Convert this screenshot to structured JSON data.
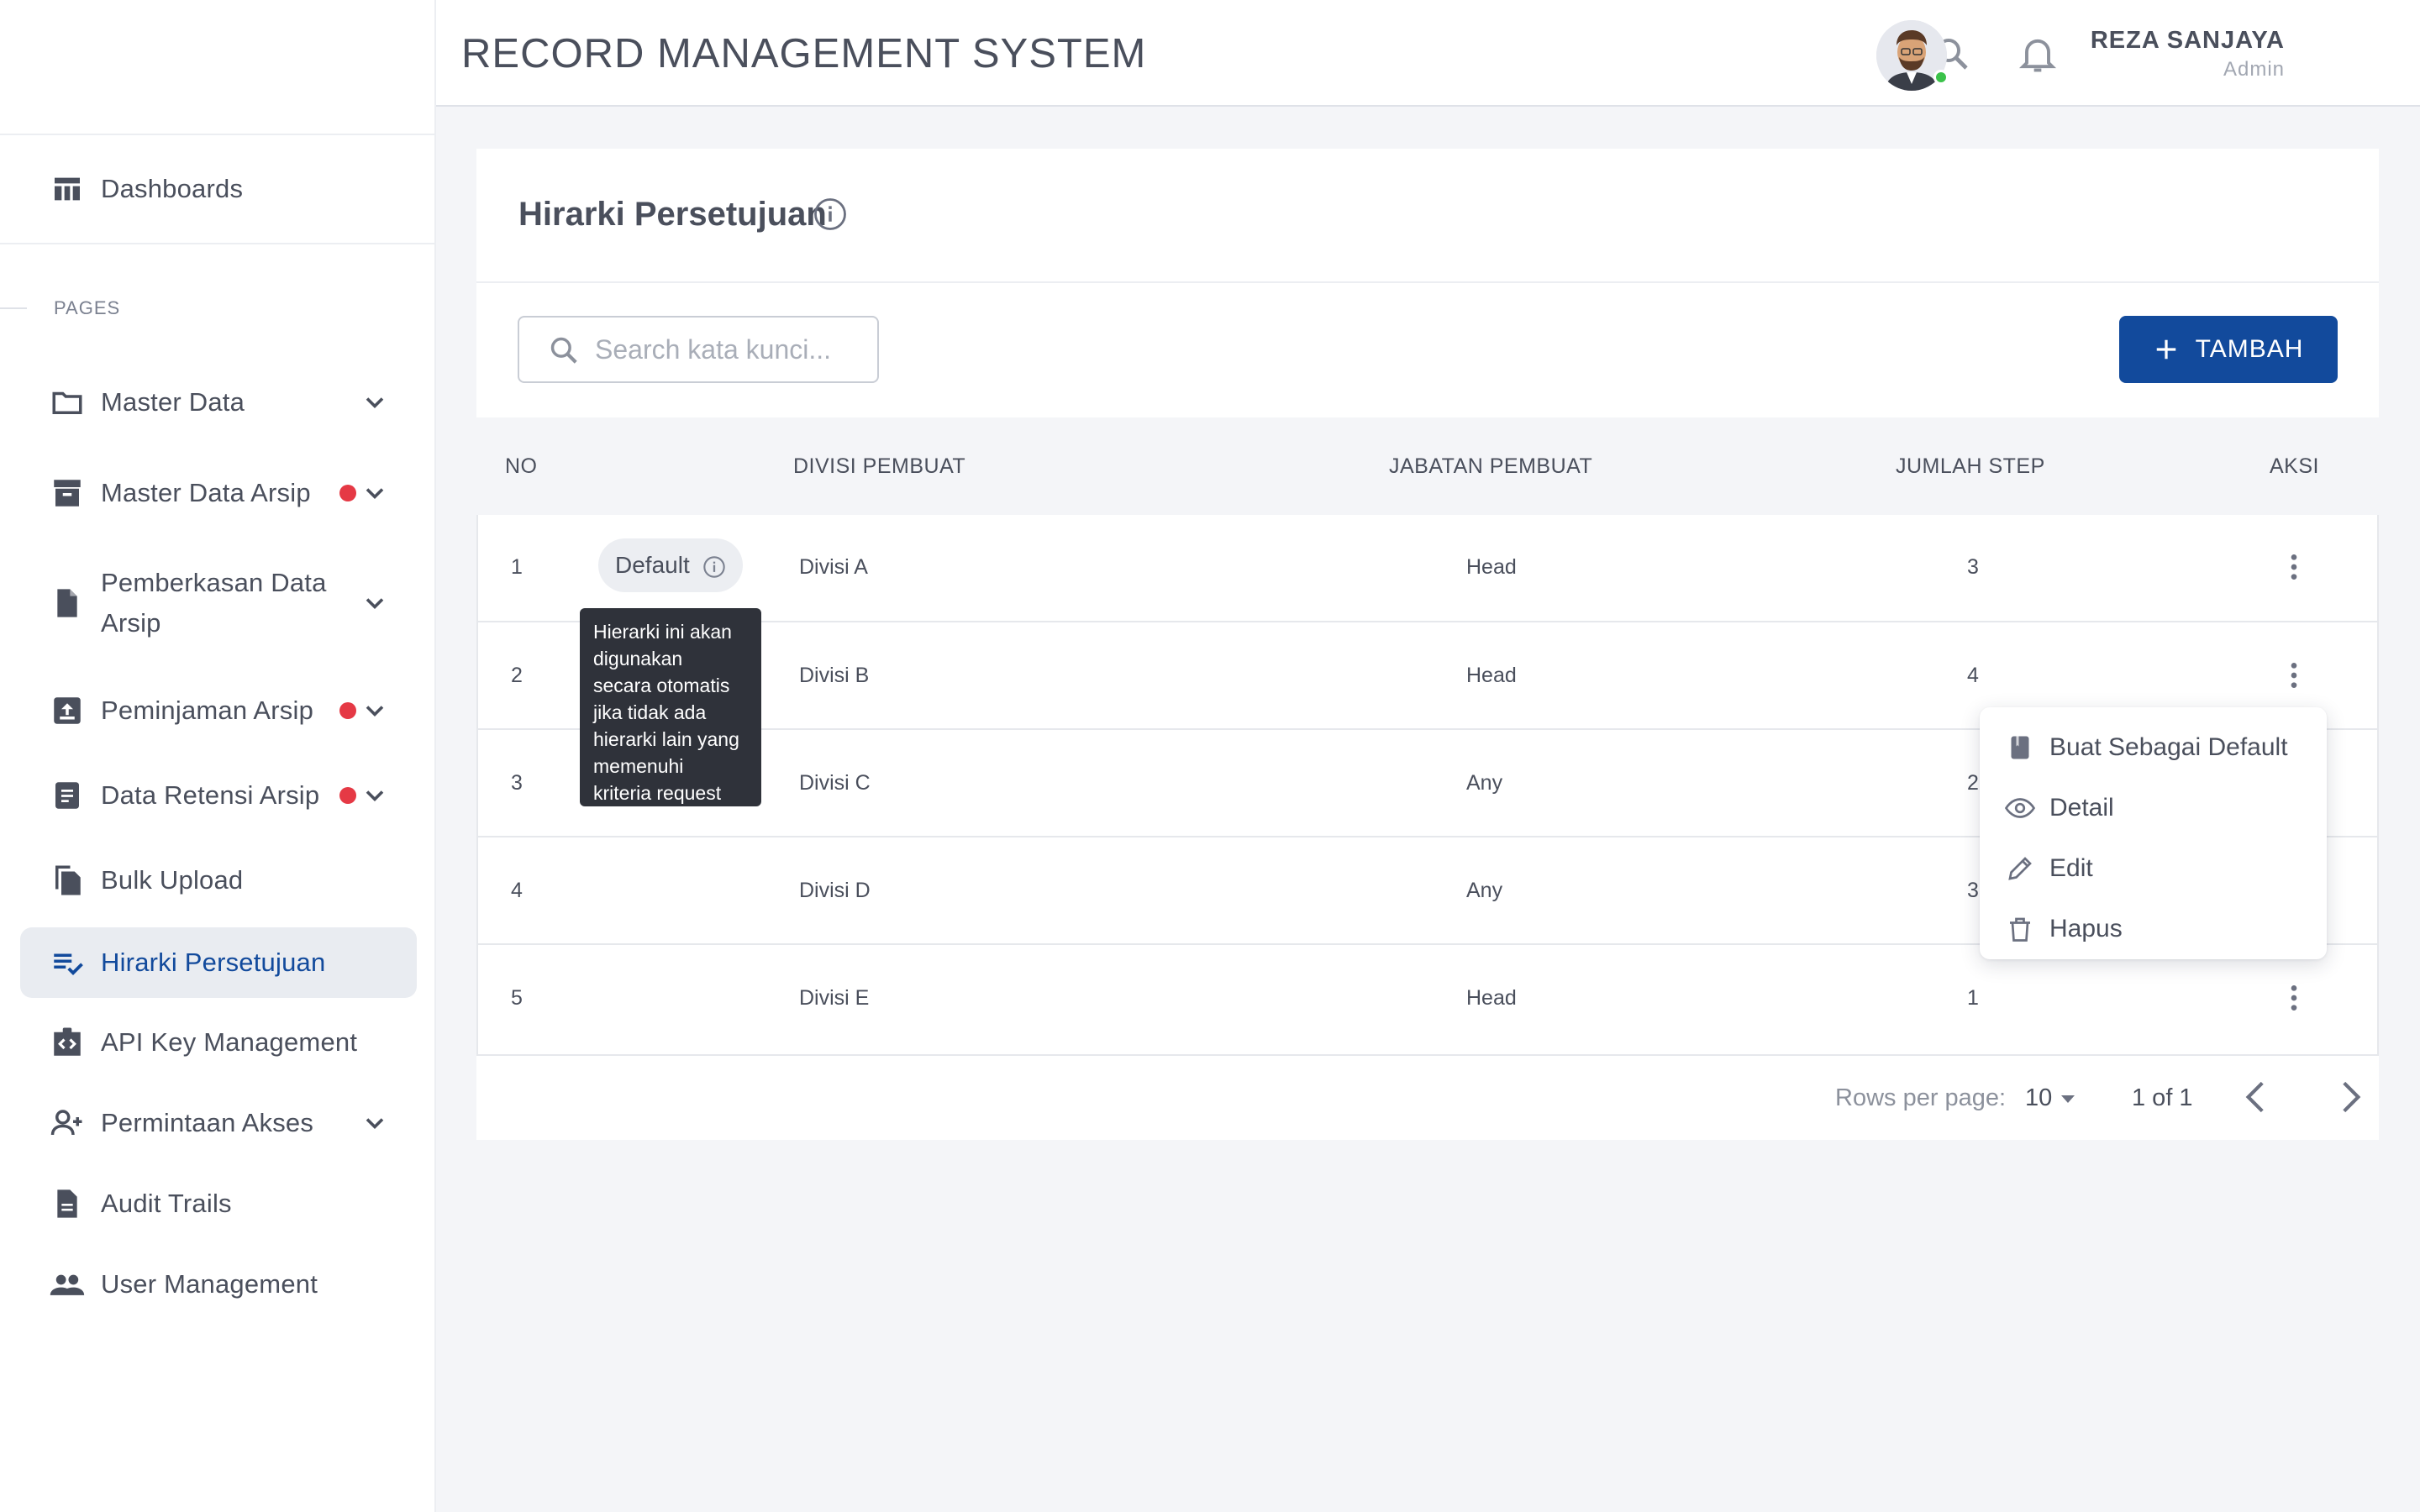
{
  "app": {
    "title": "RECORD MANAGEMENT SYSTEM"
  },
  "user": {
    "name": "REZA SANJAYA",
    "role": "Admin"
  },
  "sidebar": {
    "dashboard": "Dashboards",
    "section": "PAGES",
    "items": [
      {
        "label": "Master Data",
        "icon": "folder-icon",
        "dot": false,
        "chevron": true
      },
      {
        "label": "Master Data Arsip",
        "icon": "archive-icon",
        "dot": true,
        "chevron": true
      },
      {
        "label": "Pemberkasan Data Arsip",
        "icon": "document-icon",
        "dot": false,
        "chevron": true
      },
      {
        "label": "Peminjaman Arsip",
        "icon": "upload-box-icon",
        "dot": true,
        "chevron": true
      },
      {
        "label": "Data Retensi Arsip",
        "icon": "list-document-icon",
        "dot": true,
        "chevron": true
      },
      {
        "label": "Bulk Upload",
        "icon": "copy-files-icon",
        "dot": false,
        "chevron": false
      },
      {
        "label": "Hirarki Persetujuan",
        "icon": "list-check-icon",
        "dot": false,
        "chevron": false,
        "active": true
      },
      {
        "label": "API Key Management",
        "icon": "code-badge-icon",
        "dot": false,
        "chevron": false
      },
      {
        "label": "Permintaan Akses",
        "icon": "person-add-icon",
        "dot": false,
        "chevron": true
      },
      {
        "label": "Audit Trails",
        "icon": "report-icon",
        "dot": false,
        "chevron": false
      },
      {
        "label": "User Management",
        "icon": "group-icon",
        "dot": false,
        "chevron": false
      }
    ]
  },
  "page": {
    "title": "Hirarki Persetujuan",
    "search_placeholder": "Search kata kunci...",
    "add_label": "TAMBAH"
  },
  "table": {
    "headers": {
      "no": "NO",
      "divisi": "DIVISI PEMBUAT",
      "jabatan": "JABATAN PEMBUAT",
      "step": "JUMLAH STEP",
      "aksi": "AKSI"
    },
    "rows": [
      {
        "no": "1",
        "divisi": "Divisi A",
        "jabatan": "Head",
        "step": "3"
      },
      {
        "no": "2",
        "divisi": "Divisi B",
        "jabatan": "Head",
        "step": "4"
      },
      {
        "no": "3",
        "divisi": "Divisi C",
        "jabatan": "Any",
        "step": "2"
      },
      {
        "no": "4",
        "divisi": "Divisi D",
        "jabatan": "Any",
        "step": "3"
      },
      {
        "no": "5",
        "divisi": "Divisi E",
        "jabatan": "Head",
        "step": "1"
      }
    ],
    "default_chip": "Default",
    "tooltip_lines": [
      "Hierarki ini akan",
      "digunakan",
      "secara otomatis",
      "jika tidak ada",
      "hierarki lain yang",
      "memenuhi",
      "kriteria request"
    ]
  },
  "menu": {
    "items": [
      {
        "label": "Buat Sebagai Default",
        "icon": "bookmark-icon"
      },
      {
        "label": "Detail",
        "icon": "eye-icon"
      },
      {
        "label": "Edit",
        "icon": "pencil-icon"
      },
      {
        "label": "Hapus",
        "icon": "trash-icon"
      }
    ]
  },
  "pagination": {
    "rows_label": "Rows per page:",
    "rows_value": "10",
    "range": "1 of 1"
  },
  "colors": {
    "primary": "#124a9c",
    "badge_red": "#e53945",
    "status_online": "#3bc24a",
    "active_bg": "#e9ecf1"
  }
}
